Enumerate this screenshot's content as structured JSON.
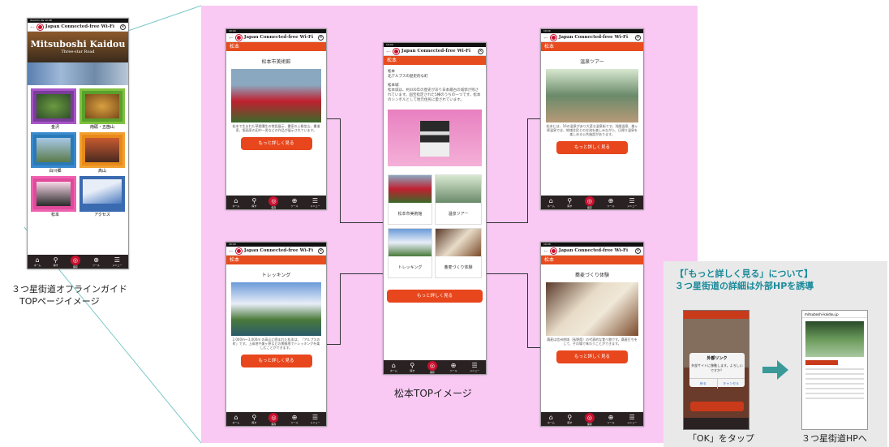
{
  "status_bar_left": "docomo 4G",
  "status_bar_time": "12:48",
  "status_bar_battery": "98%",
  "status_bar_time_detail": "10:24",
  "url_title": "Japan Connected-free Wi-Fi",
  "banner": {
    "line1": "Mitsuboshi Kaidou",
    "line2": "Three-star Road"
  },
  "top_tiles": [
    "金沢",
    "南砺・五箇山",
    "白川郷",
    "高山",
    "松本",
    "アクセス"
  ],
  "tabs": [
    "ホーム",
    "探す",
    "保存",
    "ツール",
    "メニュー"
  ],
  "top_caption": {
    "line1": "３つ星街道オフラインガイド",
    "line2": "TOPページイメージ"
  },
  "section": "松本",
  "detail_pages": [
    {
      "title": "松本市美術館",
      "text": "松本で生まれた草間彌生の常設展示、書家の上條信山、書道家、版画家の田中一男などの作品が展示されています。"
    },
    {
      "title": "温泉ツアー",
      "text": "松本には、16の温泉があり大変な温泉街です。浅間温泉、美ヶ原温泉では、地域住民との交流を楽しみながら、日帰り温泉を楽しめる公共施設があります。"
    },
    {
      "title": "トレッキング",
      "text": "2,000m〜3,000m の高山に囲まれた松本は、「アルプスの町」です。上高地や美ヶ原などの景勝地でトレッキングを楽しむことができます。"
    },
    {
      "title": "蕎麦づくり体験",
      "text": "蕎麦は信州地域（長野県）の代表的な食べ物です。蕎麦打ちをして、その場で味わうことができます。"
    }
  ],
  "more_button": "もっと詳しく見る",
  "center_page": {
    "subtitle": "松本",
    "sub2": "北アルプスの歴史的な町",
    "castle_title": "松本城",
    "castle_text": "松本城は、約400年の歴史があり日本最古の城郭が残されています。国宝指定された5棟のうちの一つです。松本のシンボルとして地元住民に愛されています。",
    "grid": [
      "松本市美術館",
      "温泉ツアー",
      "トレッキング",
      "蕎麦づくり体験"
    ]
  },
  "center_caption": "松本TOPイメージ",
  "popup": {
    "heading1": "【「もっと詳しく見る」について】",
    "heading2": "３つ星街道の詳細は外部HPを誘導",
    "dialog_title": "外部リンク",
    "dialog_text": "外部サイトに移動します。よろしいですか？",
    "dialog_cancel": "戻る",
    "dialog_ok": "キャンセル",
    "left_caption": "「OK」をタップ",
    "right_caption": "３つ星街道HPへ",
    "site_url": "mitsuboshi-kaidou.jp"
  },
  "colors": {
    "pink_bg": "#f9c9f4",
    "red": "#e64c1e",
    "brand": "#c8102e",
    "teal_arrow": "#3a9a9a"
  }
}
